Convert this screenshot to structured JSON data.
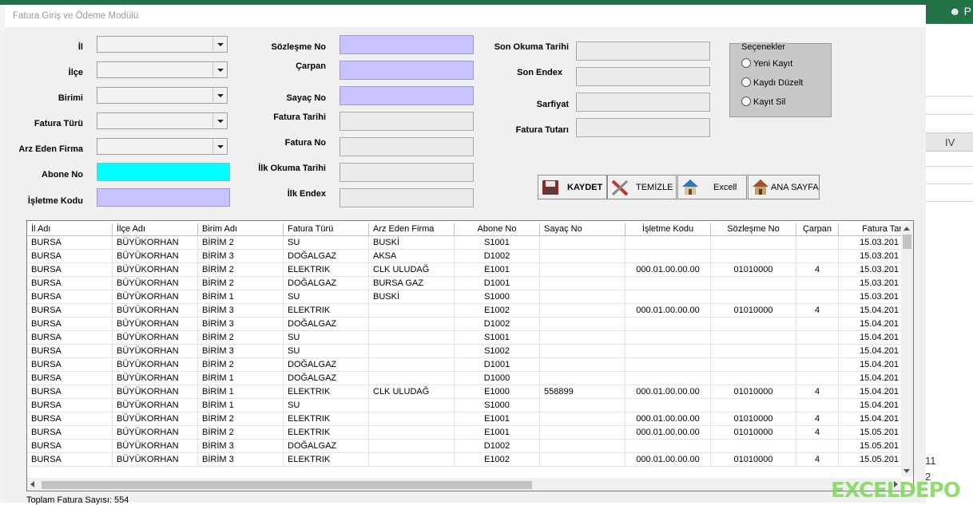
{
  "window": {
    "title": "Fatura Giriş ve Ödeme Modülü"
  },
  "excel": {
    "user_initial": "P",
    "column_header": "IV",
    "cell_a": "11",
    "cell_b": "2"
  },
  "left_fields": {
    "il": "İl",
    "ilce": "İlçe",
    "birimi": "Birimi",
    "fatura_turu": "Fatura Türü",
    "arz_eden_firma": "Arz Eden Firma",
    "abone_no": "Abone No",
    "isletme_kodu": "İşletme Kodu"
  },
  "mid_fields": {
    "sozlesme_no": "Sözleşme No",
    "carpan": "Çarpan",
    "sayac_no": "Sayaç No",
    "fatura_tarihi": "Fatura Tarihi",
    "fatura_no": "Fatura No",
    "ilk_okuma_tarihi": "İlk Okuma Tarihi",
    "ilk_endex": "İlk Endex"
  },
  "right_fields": {
    "son_okuma_tarihi": "Son Okuma Tarihi",
    "son_endex": "Son Endex",
    "sarfiyat": "Sarfiyat",
    "fatura_tutari": "Fatura Tutarı"
  },
  "options": {
    "title": "Seçenekler",
    "yeni_kayit": "Yeni Kayıt",
    "kaydi_duzelt": "Kaydı Düzelt",
    "kayit_sil": "Kayıt Sil"
  },
  "buttons": {
    "kaydet": "KAYDET",
    "temizle": "TEMİZLE",
    "excell": "Excell",
    "ana_sayfa": "ANA SAYFA"
  },
  "grid": {
    "columns": [
      "İl Adı",
      "İlçe Adı",
      "Birim Adı",
      "Fatura Türü",
      "Arz Eden Firma",
      "Abone No",
      "Sayaç No",
      "İşletme Kodu",
      "Sözleşme No",
      "Çarpan",
      "Fatura Tar"
    ],
    "rows": [
      [
        "BURSA",
        "BÜYÜKORHAN",
        "BİRİM 2",
        "SU",
        "BUSKİ",
        "S1001",
        "",
        "",
        "",
        "",
        "15.03.201"
      ],
      [
        "BURSA",
        "BÜYÜKORHAN",
        "BİRİM 3",
        "DOĞALGAZ",
        "AKSA",
        "D1002",
        "",
        "",
        "",
        "",
        "15.03.201"
      ],
      [
        "BURSA",
        "BÜYÜKORHAN",
        "BİRİM 2",
        "ELEKTRIK",
        "CLK ULUDAĞ",
        "E1001",
        "",
        "000.01.00.00.00",
        "01010000",
        "4",
        "15.03.201"
      ],
      [
        "BURSA",
        "BÜYÜKORHAN",
        "BİRİM 2",
        "DOĞALGAZ",
        "BURSA GAZ",
        "D1001",
        "",
        "",
        "",
        "",
        "15.03.201"
      ],
      [
        "BURSA",
        "BÜYÜKORHAN",
        "BİRİM 1",
        "SU",
        "BUSKİ",
        "S1000",
        "",
        "",
        "",
        "",
        "15.03.201"
      ],
      [
        "BURSA",
        "BÜYÜKORHAN",
        "BİRİM 3",
        "ELEKTRIK",
        "",
        "E1002",
        "",
        "000.01.00.00.00",
        "01010000",
        "4",
        "15.04.201"
      ],
      [
        "BURSA",
        "BÜYÜKORHAN",
        "BİRİM 3",
        "DOĞALGAZ",
        "",
        "D1002",
        "",
        "",
        "",
        "",
        "15.04.201"
      ],
      [
        "BURSA",
        "BÜYÜKORHAN",
        "BİRİM 2",
        "SU",
        "",
        "S1001",
        "",
        "",
        "",
        "",
        "15.04.201"
      ],
      [
        "BURSA",
        "BÜYÜKORHAN",
        "BİRİM 3",
        "SU",
        "",
        "S1002",
        "",
        "",
        "",
        "",
        "15.04.201"
      ],
      [
        "BURSA",
        "BÜYÜKORHAN",
        "BİRİM 2",
        "DOĞALGAZ",
        "",
        "D1001",
        "",
        "",
        "",
        "",
        "15.04.201"
      ],
      [
        "BURSA",
        "BÜYÜKORHAN",
        "BİRİM 1",
        "DOĞALGAZ",
        "",
        "D1000",
        "",
        "",
        "",
        "",
        "15.04.201"
      ],
      [
        "BURSA",
        "BÜYÜKORHAN",
        "BİRİM 1",
        "ELEKTRIK",
        "CLK ULUDAĞ",
        "E1000",
        "558899",
        "000.01.00.00.00",
        "01010000",
        "4",
        "15.04.201"
      ],
      [
        "BURSA",
        "BÜYÜKORHAN",
        "BİRİM 1",
        "SU",
        "",
        "S1000",
        "",
        "",
        "",
        "",
        "15.04.201"
      ],
      [
        "BURSA",
        "BÜYÜKORHAN",
        "BİRİM 2",
        "ELEKTRIK",
        "",
        "E1001",
        "",
        "000.01.00.00.00",
        "01010000",
        "4",
        "15.04.201"
      ],
      [
        "BURSA",
        "BÜYÜKORHAN",
        "BİRİM 2",
        "ELEKTRIK",
        "",
        "E1001",
        "",
        "000.01.00.00.00",
        "01010000",
        "4",
        "15.05.201"
      ],
      [
        "BURSA",
        "BÜYÜKORHAN",
        "BİRİM 3",
        "DOĞALGAZ",
        "",
        "D1002",
        "",
        "",
        "",
        "",
        "15.05.201"
      ],
      [
        "BURSA",
        "BÜYÜKORHAN",
        "BİRİM 3",
        "ELEKTRIK",
        "",
        "E1002",
        "",
        "000.01.00.00.00",
        "01010000",
        "4",
        "15.05.201"
      ]
    ]
  },
  "status": {
    "total_label": "Toplam Fatura Sayısı: 554"
  },
  "watermark": "EXCELDEPO"
}
